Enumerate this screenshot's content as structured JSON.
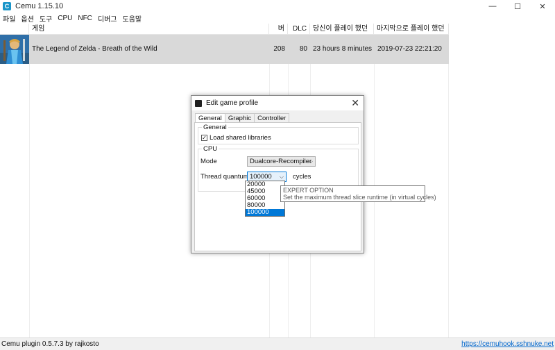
{
  "window": {
    "title": "Cemu 1.15.10",
    "icon_letter": "C",
    "controls": {
      "minimize": "—",
      "maximize": "☐",
      "close": "✕"
    }
  },
  "menu": [
    "파일",
    "옵션",
    "도구",
    "CPU",
    "NFC",
    "디버그",
    "도움말"
  ],
  "list": {
    "headers": {
      "game": "게임",
      "version": "버전",
      "dlc": "DLC",
      "played": "당신이 플레이 했던 것",
      "last_played": "마지막으로 플레이 했던 것"
    },
    "rows": [
      {
        "title": "The Legend of Zelda - Breath of the Wild",
        "version": "208",
        "dlc": "80",
        "played": "23 hours 8 minutes",
        "last_played": "2019-07-23 22:21:20"
      }
    ]
  },
  "status": {
    "left": "Cemu plugin 0.5.7.3 by rajkosto",
    "right": "https://cemuhook.sshnuke.net"
  },
  "dialog": {
    "title": "Edit game profile",
    "close": "✕",
    "tabs": [
      "General",
      "Graphic",
      "Controller"
    ],
    "general_group": {
      "title": "General",
      "load_shared_libraries": {
        "label": "Load shared libraries",
        "checked": "✓"
      }
    },
    "cpu_group": {
      "title": "CPU",
      "mode_label": "Mode",
      "mode_value": "Dualcore-Recompiler",
      "thread_label": "Thread quantum",
      "thread_value": "100000",
      "thread_unit": "cycles",
      "thread_options": [
        "20000",
        "45000",
        "60000",
        "80000",
        "100000"
      ],
      "selected_option": "100000"
    },
    "tooltip": {
      "title": "EXPERT OPTION",
      "body": "Set the maximum thread slice runtime (in virtual cycles)"
    }
  },
  "colors": {
    "selected_row": "#d9d9d9",
    "accent": "#0078d7",
    "link": "#0066cc"
  }
}
